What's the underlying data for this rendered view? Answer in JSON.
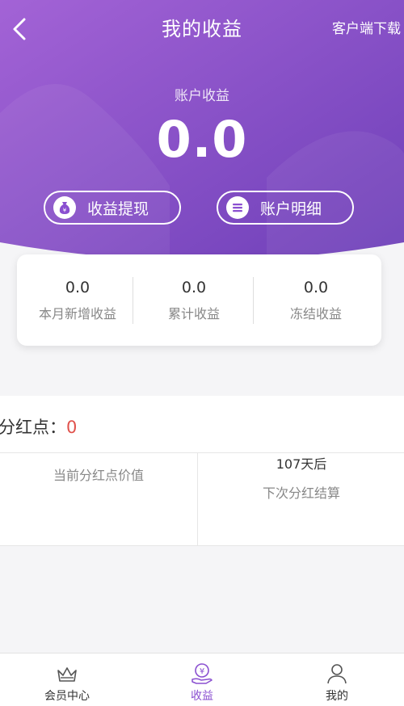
{
  "header": {
    "title": "我的收益",
    "download_label": "客户端下载",
    "back_icon": "chevron-left-icon"
  },
  "earnings": {
    "label": "账户收益",
    "value": "0.0"
  },
  "actions": {
    "withdraw_label": "收益提现",
    "withdraw_icon": "money-bag-icon",
    "detail_label": "账户明细",
    "detail_icon": "list-icon"
  },
  "stats": [
    {
      "value": "0.0",
      "label": "本月新增收益"
    },
    {
      "value": "0.0",
      "label": "累计收益"
    },
    {
      "value": "0.0",
      "label": "冻结收益"
    }
  ],
  "dividend": {
    "label": "分红点：",
    "count": "0",
    "current_value_caption": "当前分红点价值",
    "next_days": "107天后",
    "next_caption": "下次分红结算"
  },
  "tabbar": {
    "items": [
      {
        "label": "会员中心",
        "icon": "crown-icon",
        "active": false
      },
      {
        "label": "收益",
        "icon": "coin-hand-icon",
        "active": true
      },
      {
        "label": "我的",
        "icon": "person-icon",
        "active": false
      }
    ]
  },
  "colors": {
    "header_gradient_start": "#a363d6",
    "header_gradient_end": "#6d3fb8",
    "accent": "#8a4fd0",
    "dividend_count": "#e0524c"
  }
}
